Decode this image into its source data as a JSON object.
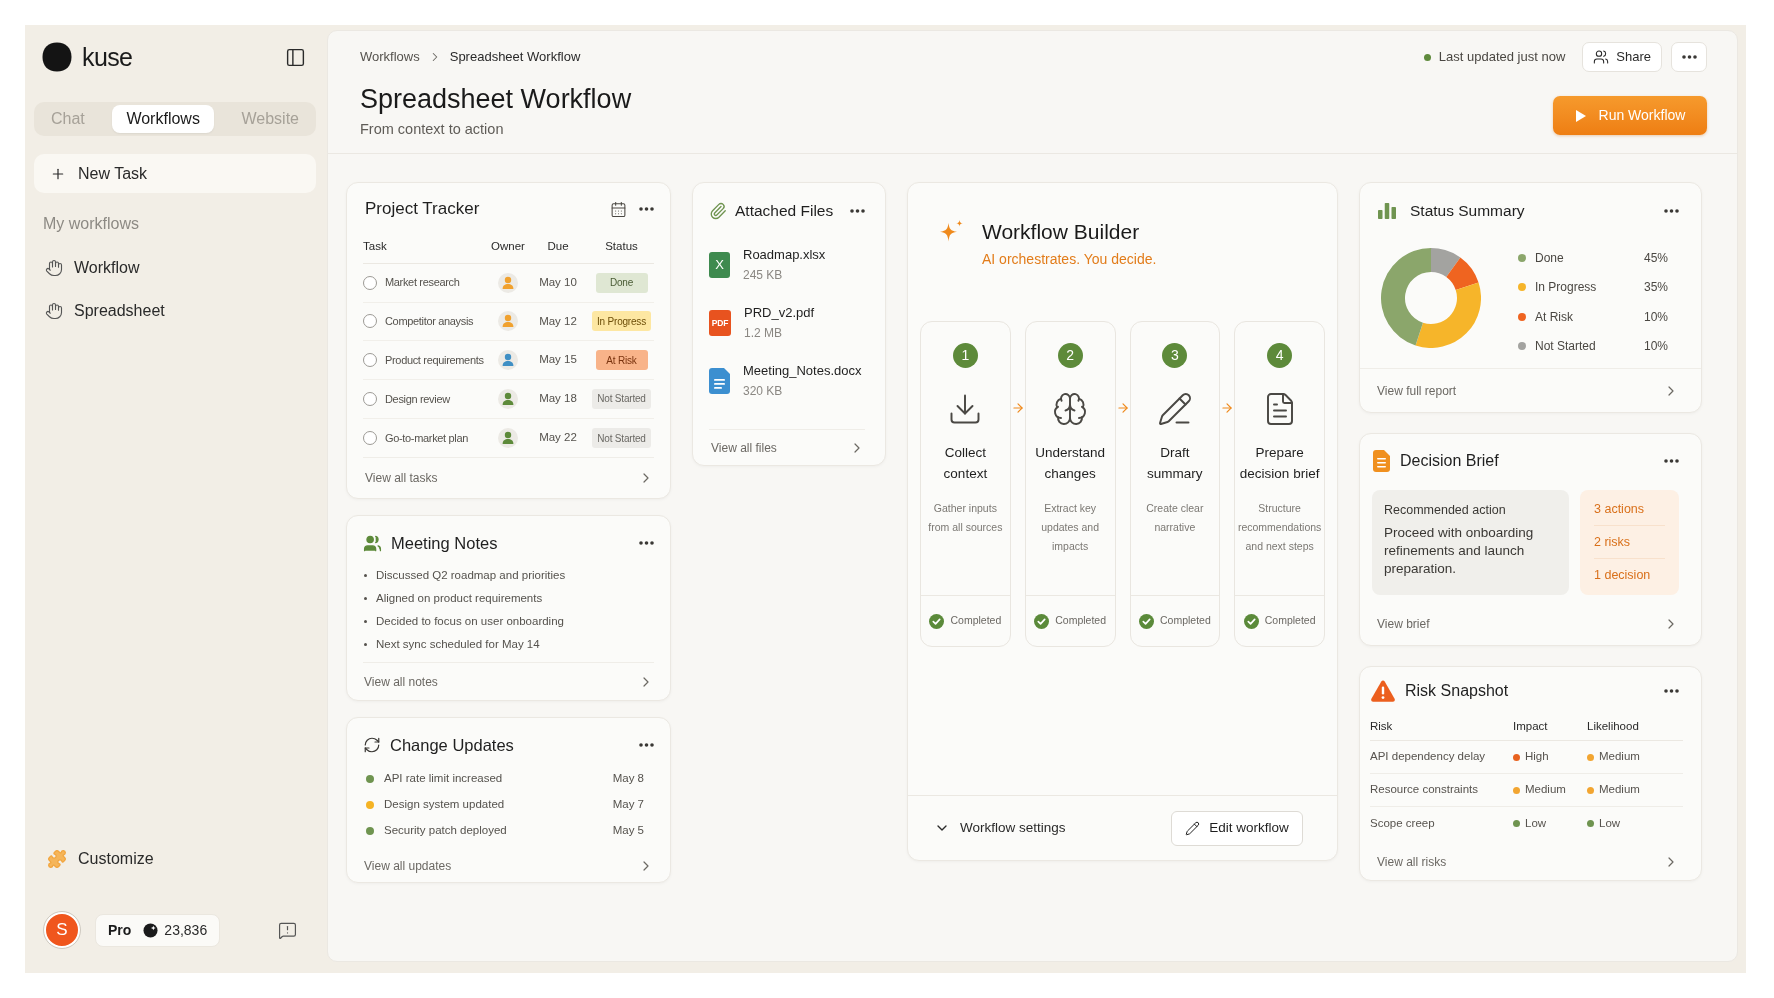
{
  "sidebar": {
    "brand": "kuse",
    "tabs": [
      {
        "label": "Chat",
        "selected": false
      },
      {
        "label": "Workflows",
        "selected": true
      },
      {
        "label": "Website",
        "selected": false
      }
    ],
    "new_task_button": "New Task",
    "section_title": "My workflows",
    "items": [
      {
        "label": "Workflow"
      },
      {
        "label": "Spreadsheet"
      }
    ],
    "customize": "Customize",
    "account": {
      "avatar_initial": "S",
      "plan": "Pro",
      "credits": "23,836"
    }
  },
  "header": {
    "breadcrumb": [
      "Workflows",
      "Spreadsheet Workflow"
    ],
    "title": "Spreadsheet Workflow",
    "subtitle": "From context to action",
    "update_status": "Last updated just now",
    "share_button": "Share",
    "run_button": "Run Workflow"
  },
  "project_tracker": {
    "title": "Project Tracker",
    "columns": [
      "Task",
      "Owner",
      "Due",
      "Status"
    ],
    "rows": [
      {
        "task": "Market research",
        "checked": false,
        "owner": {
          "color": "#f0a12e"
        },
        "due": "May 10",
        "status": {
          "label": "Done",
          "kind": "done"
        }
      },
      {
        "task": "Competitor anaysis",
        "checked": false,
        "owner": {
          "color": "#f0a12e"
        },
        "due": "May 12",
        "status": {
          "label": "In Progress",
          "kind": "in_progress"
        }
      },
      {
        "task": "Product requirements",
        "checked": false,
        "owner": {
          "color": "#3f8fc4"
        },
        "due": "May 15",
        "status": {
          "label": "At Risk",
          "kind": "at_risk"
        }
      },
      {
        "task": "Design review",
        "checked": false,
        "owner": {
          "color": "#5d8a3a"
        },
        "due": "May 18",
        "status": {
          "label": "Not Started",
          "kind": "not_started"
        }
      },
      {
        "task": "Go-to-market plan",
        "checked": false,
        "owner": {
          "color": "#5d8a3a"
        },
        "due": "May 22",
        "status": {
          "label": "Not Started",
          "kind": "not_started"
        }
      }
    ],
    "footer_link": "View all tasks"
  },
  "meeting_notes": {
    "title": "Meeting Notes",
    "notes": [
      "Discussed Q2 roadmap and priorities",
      "Aligned on product requirements",
      "Decided to focus on user onboarding",
      "Next sync scheduled for May 14"
    ],
    "footer_link": "View all notes"
  },
  "change_updates": {
    "title": "Change Updates",
    "items": [
      {
        "text": "API rate limit increased",
        "date": "May 8",
        "color": "#6f9450"
      },
      {
        "text": "Design system updated",
        "date": "May 7",
        "color": "#f5b324"
      },
      {
        "text": "Security patch deployed",
        "date": "May 5",
        "color": "#6f9450"
      }
    ],
    "footer_link": "View all updates"
  },
  "attached_files": {
    "title": "Attached Files",
    "files": [
      {
        "name": "Roadmap.xlsx",
        "size": "245 KB",
        "kind": "spreadsheet",
        "icon_text": "X"
      },
      {
        "name": "PRD_v2.pdf",
        "size": "1.2 MB",
        "kind": "pdf",
        "icon_text": "PDF"
      },
      {
        "name": "Meeting_Notes.docx",
        "size": "320 KB",
        "kind": "document"
      }
    ],
    "footer_link": "View all files"
  },
  "workflow_builder": {
    "title": "Workflow Builder",
    "subtitle": "AI orchestrates. You decide.",
    "steps": [
      {
        "number": "1",
        "title": "Collect context",
        "description": "Gather inputs from all sources",
        "status": "Completed",
        "completed": true,
        "kind": "collect"
      },
      {
        "number": "2",
        "title": "Understand changes",
        "description": "Extract key updates and impacts",
        "status": "Completed",
        "completed": true,
        "kind": "analyze"
      },
      {
        "number": "3",
        "title": "Draft summary",
        "description": "Create clear narrative",
        "status": "Completed",
        "completed": true,
        "kind": "draft"
      },
      {
        "number": "4",
        "title": "Prepare decision brief",
        "description": "Structure recommendations and next steps",
        "status": "Completed",
        "completed": true,
        "kind": "brief"
      }
    ],
    "settings_toggle": "Workflow settings",
    "edit_button": "Edit workflow"
  },
  "status_summary": {
    "title": "Status Summary",
    "chart_data": {
      "type": "donut",
      "categories": [
        "Done",
        "In Progress",
        "At Risk",
        "Not Started"
      ],
      "values": [
        45,
        35,
        10,
        10
      ]
    },
    "legend": [
      {
        "value": "45%",
        "color": "#8ba66b"
      },
      {
        "value": "35%",
        "color": "#f6b52a"
      },
      {
        "value": "10%",
        "color": "#ef6420"
      },
      {
        "value": "10%",
        "color": "#a3a3a0"
      }
    ],
    "footer_link": "View full report"
  },
  "decision_brief": {
    "title": "Decision Brief",
    "recommendation_label": "Recommended action",
    "recommendation": "Proceed with onboarding refinements and launch preparation.",
    "summary_counts": [
      "3 actions",
      "2 risks",
      "1 decision"
    ],
    "footer_link": "View brief"
  },
  "risk_snapshot": {
    "title": "Risk Snapshot",
    "columns": [
      "Risk",
      "Impact",
      "Likelihood"
    ],
    "rows": [
      {
        "risk": "API dependency delay",
        "impact": {
          "label": "High",
          "color": "#e8621f"
        },
        "likelihood": {
          "label": "Medium",
          "color": "#f2a531"
        }
      },
      {
        "risk": "Resource constraints",
        "impact": {
          "label": "Medium",
          "color": "#f2a531"
        },
        "likelihood": {
          "label": "Medium",
          "color": "#f2a531"
        }
      },
      {
        "risk": "Scope creep",
        "impact": {
          "label": "Low",
          "color": "#6f9450"
        },
        "likelihood": {
          "label": "Low",
          "color": "#6f9450"
        }
      }
    ],
    "footer_link": "View all risks"
  }
}
